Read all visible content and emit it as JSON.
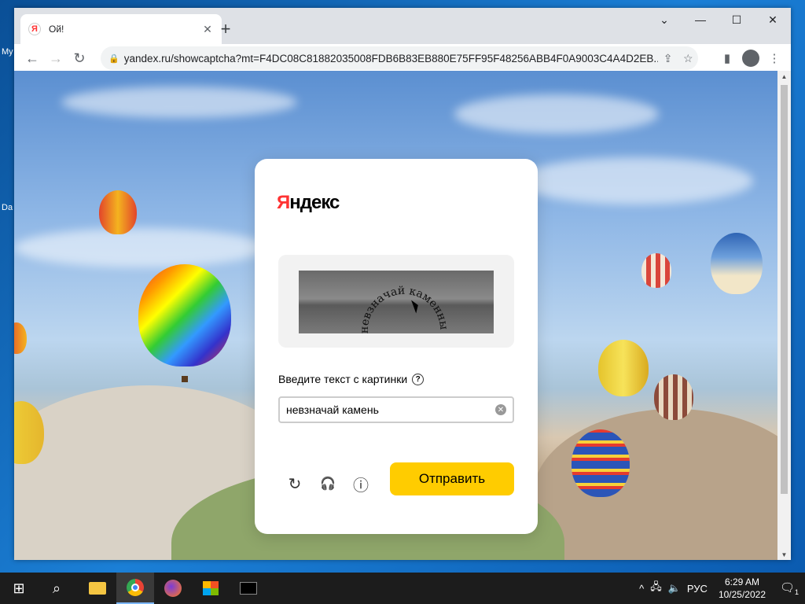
{
  "desktop": {
    "labels": [
      "My",
      "Da"
    ]
  },
  "browser": {
    "tab_title": "Ой!",
    "favicon_letter": "Я",
    "tab_close": "✕",
    "new_tab": "+",
    "window_controls": {
      "dropdown": "⌄",
      "minimize": "—",
      "maximize": "☐",
      "close": "✕"
    },
    "url": "yandex.ru/showcaptcha?mt=F4DC08C81882035008FDB6B83EB880E75FF95F48256ABB4F0A9003C4A4D2EB...",
    "nav": {
      "back": "←",
      "forward": "→",
      "reload": "↻"
    },
    "toolbar_icons": {
      "share": "⇪",
      "bookmark": "☆",
      "sidebar": "▮",
      "menu": "⋮"
    }
  },
  "captcha": {
    "logo_first": "Я",
    "logo_rest": "ндекс",
    "captcha_text": "невзначай каменным",
    "prompt": "Введите текст с картинки",
    "help": "?",
    "input_value": "невзначай камень",
    "clear": "✕",
    "icons": {
      "refresh": "↻",
      "audio": "🎧",
      "info": "ⓘ"
    },
    "submit_label": "Отправить"
  },
  "taskbar": {
    "start": "⊞",
    "search": "⌕",
    "apps": [
      "explorer",
      "chrome",
      "firefox",
      "store",
      "terminal"
    ],
    "tray": {
      "chevron": "^",
      "language": "РУС",
      "time": "6:29 AM",
      "date": "10/25/2022",
      "notif_count": "1"
    }
  },
  "colors": {
    "accent": "#ffcc00",
    "yandex_red": "#ff3333"
  }
}
